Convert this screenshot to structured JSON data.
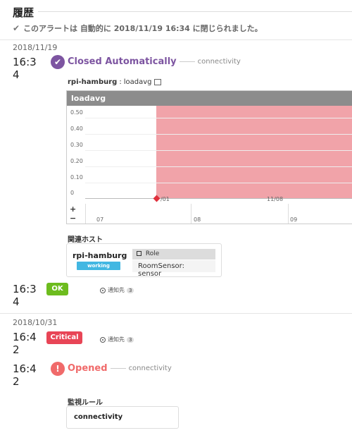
{
  "header": {
    "title": "履歴"
  },
  "closed_message": "このアラートは 自動的に 2018/11/19 16:34 に閉じられました。",
  "groups": [
    {
      "date": "2018/11/19"
    },
    {
      "date": "2018/10/31"
    }
  ],
  "events": {
    "closed": {
      "time": "16:34",
      "title": "Closed Automatically",
      "rule": "connectivity",
      "color": "#7d55a1"
    },
    "ok": {
      "time": "16:34",
      "status": "OK",
      "notify": "通知先",
      "count": "3",
      "color": "#6dbc1e"
    },
    "critical": {
      "time": "16:42",
      "status": "Critical",
      "notify": "通知先",
      "count": "3",
      "color": "#e84556"
    },
    "opened": {
      "time": "16:42",
      "title": "Opened",
      "rule": "connectivity",
      "color": "#f06a6a"
    }
  },
  "graph": {
    "host": "rpi-hamburg",
    "metric": "loadavg",
    "title": "loadavg",
    "y_ticks": [
      "0.50",
      "0.40",
      "0.30",
      "0.20",
      "0.10",
      "0"
    ],
    "x_ticks_top": [
      "/01",
      "11/08"
    ],
    "x_ticks_bottom": [
      "07",
      "08",
      "09"
    ],
    "zoom_in": "+",
    "zoom_out": "−",
    "alert_color": "#f1a3a9"
  },
  "related_hosts": {
    "label": "関連ホスト",
    "host": "rpi-hamburg",
    "status": "working",
    "role_header": "Role",
    "role": "RoomSensor: sensor"
  },
  "monitor_rule": {
    "label": "監視ルール",
    "name": "connectivity"
  }
}
